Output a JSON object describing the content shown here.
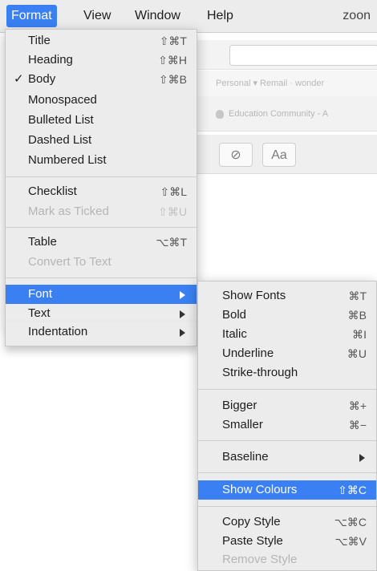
{
  "menubar": {
    "items": [
      "Format",
      "View",
      "Window",
      "Help"
    ],
    "right_text": "zoon"
  },
  "background": {
    "bookmarks_text": "Personal ▾   Remail · wonder",
    "tab_text": "Education Community - A"
  },
  "format_menu": {
    "items": [
      {
        "label": "Title",
        "shortcut": "⇧⌘T"
      },
      {
        "label": "Heading",
        "shortcut": "⇧⌘H"
      },
      {
        "label": "Body",
        "shortcut": "⇧⌘B",
        "check": "✓"
      },
      {
        "label": "Monospaced",
        "shortcut": ""
      },
      {
        "label": "Bulleted List",
        "shortcut": ""
      },
      {
        "label": "Dashed List",
        "shortcut": ""
      },
      {
        "label": "Numbered List",
        "shortcut": ""
      },
      {
        "label": "Checklist",
        "shortcut": "⇧⌘L"
      },
      {
        "label": "Mark as Ticked",
        "shortcut": "⇧⌘U"
      },
      {
        "label": "Table",
        "shortcut": "⌥⌘T"
      },
      {
        "label": "Convert To Text",
        "shortcut": ""
      },
      {
        "label": "Font",
        "shortcut": ""
      },
      {
        "label": "Text",
        "shortcut": ""
      },
      {
        "label": "Indentation",
        "shortcut": ""
      }
    ]
  },
  "font_submenu": {
    "items": [
      {
        "label": "Show Fonts",
        "shortcut": "⌘T"
      },
      {
        "label": "Bold",
        "shortcut": "⌘B"
      },
      {
        "label": "Italic",
        "shortcut": "⌘I"
      },
      {
        "label": "Underline",
        "shortcut": "⌘U"
      },
      {
        "label": "Strike-through",
        "shortcut": ""
      },
      {
        "label": "Bigger",
        "shortcut": "⌘+"
      },
      {
        "label": "Smaller",
        "shortcut": "⌘−"
      },
      {
        "label": "Baseline",
        "shortcut": ""
      },
      {
        "label": "Show Colours",
        "shortcut": "⇧⌘C"
      },
      {
        "label": "Copy Style",
        "shortcut": "⌥⌘C"
      },
      {
        "label": "Paste Style",
        "shortcut": "⌥⌘V"
      },
      {
        "label": "Remove Style",
        "shortcut": ""
      }
    ]
  },
  "format_toolbar": {
    "check_glyph": "⊘",
    "font_button": "Aa"
  },
  "colors": {
    "highlight": "#3a80f2",
    "menu_bg": "#ececec",
    "disabled_text": "#b5b5b5"
  }
}
